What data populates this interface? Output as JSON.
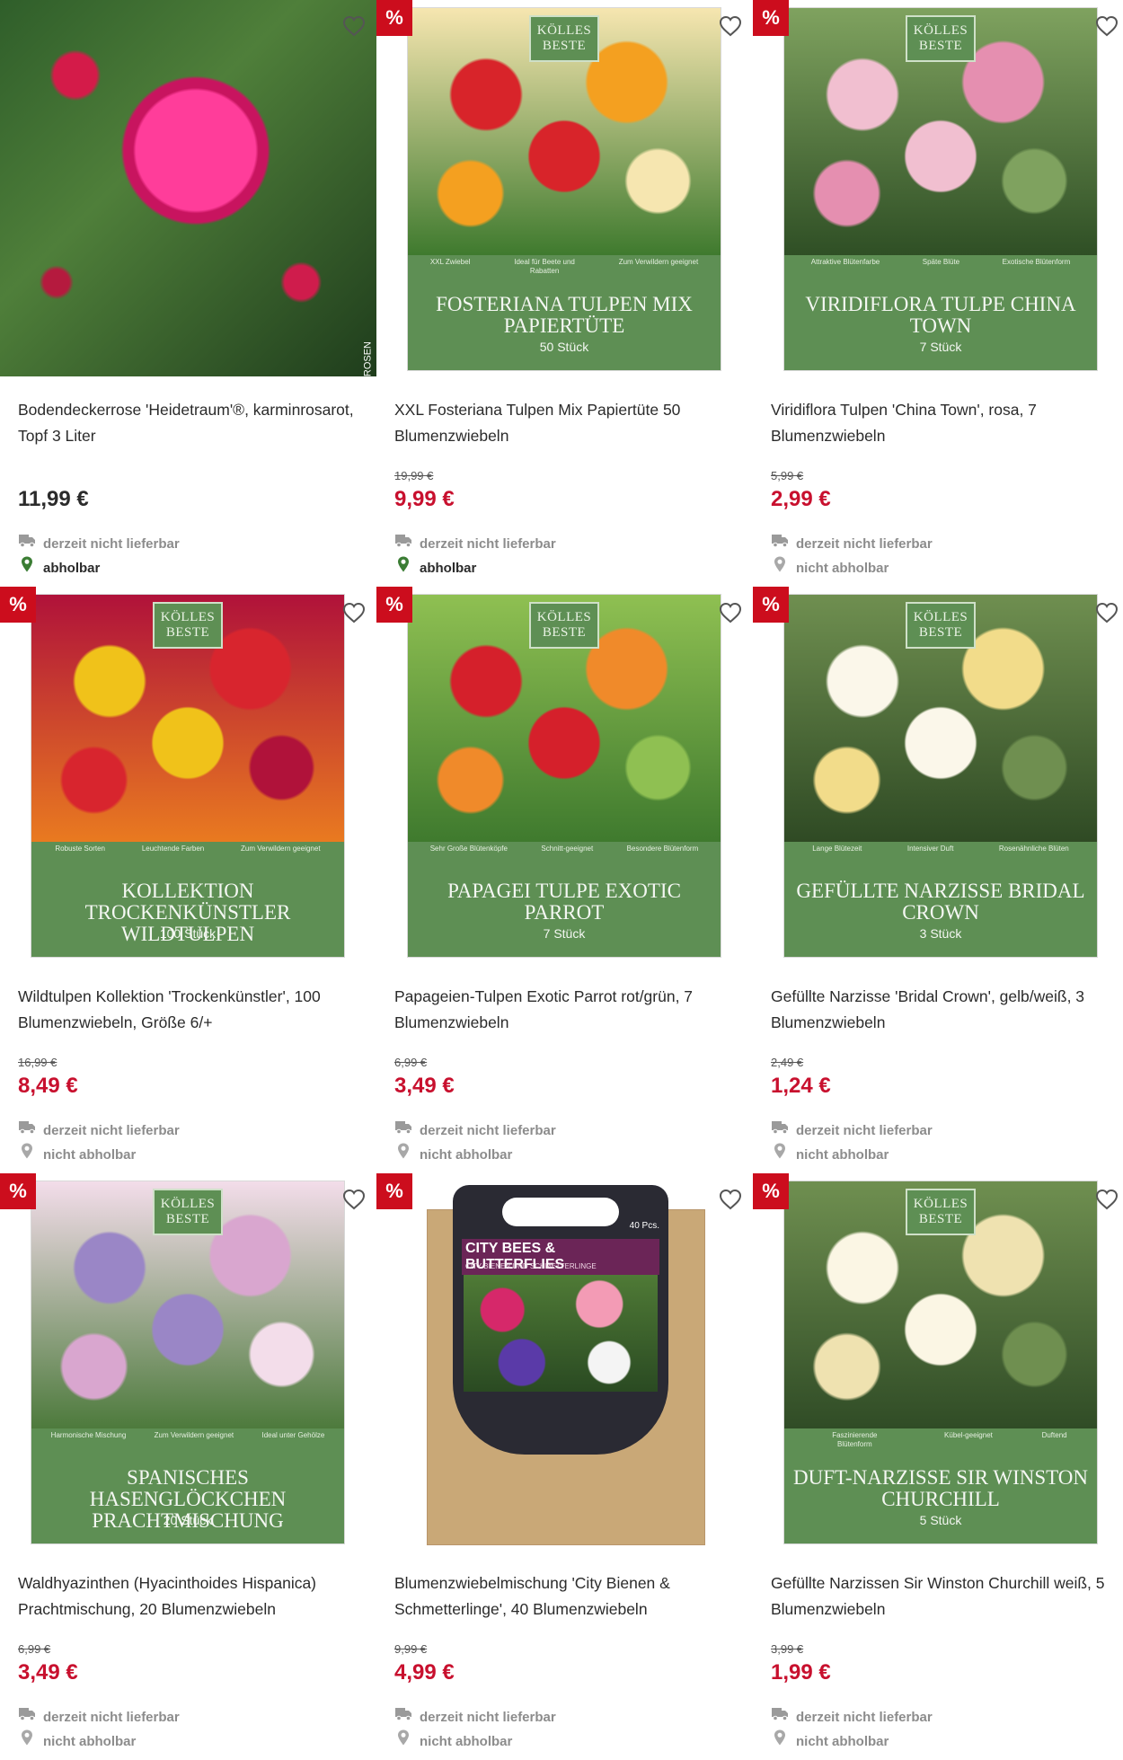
{
  "colors": {
    "sale_badge": "#cc0d1d",
    "sale_price": "#c8102e",
    "pack_green": "#5e8f54",
    "available_pin": "#3b7d34",
    "unavailable_text": "#8c8c8c"
  },
  "products": [
    {
      "title": "Bodendeckerrose 'Heidetraum'®, karminrosarot, Topf 3 Liter",
      "old_price": "",
      "price": "11,99 €",
      "sale": false,
      "delivery": "derzeit nicht lieferbar",
      "pickup": "abholbar",
      "pickup_available": true,
      "image": {
        "kind": "rose-photo",
        "credit": "© NOACK ROSEN"
      }
    },
    {
      "title": "XXL Fosteriana Tulpen Mix Papiertüte 50 Blumenzwiebeln",
      "old_price": "19,99 €",
      "price": "9,99 €",
      "sale": true,
      "delivery": "derzeit nicht lieferbar",
      "pickup": "abholbar",
      "pickup_available": true,
      "image": {
        "kind": "pack",
        "brand": "KÖLLES BESTE",
        "photo_colors": [
          "#d8242a",
          "#f4a020",
          "#f6e6b0",
          "#3f7a2e"
        ],
        "features": [
          "XXL Zwiebel",
          "Ideal für Beete und Rabatten",
          "Zum Verwildern geeignet"
        ],
        "pack_title": "FOSTERIANA TULPEN MIX PAPIERTÜTE",
        "count": "50 Stück"
      }
    },
    {
      "title": "Viridiflora Tulpen 'China Town', rosa, 7 Blumenzwiebeln",
      "old_price": "5,99 €",
      "price": "2,99 €",
      "sale": true,
      "delivery": "derzeit nicht lieferbar",
      "pickup": "nicht abholbar",
      "pickup_available": false,
      "image": {
        "kind": "pack",
        "brand": "KÖLLES BESTE",
        "photo_colors": [
          "#f1bfd0",
          "#e58fb0",
          "#7fa25f",
          "#2f4f25"
        ],
        "features": [
          "Attraktive Blütenfarbe",
          "Späte Blüte",
          "Exotische Blütenform"
        ],
        "pack_title": "VIRIDIFLORA TULPE CHINA TOWN",
        "count": "7 Stück"
      }
    },
    {
      "title": "Wildtulpen Kollektion 'Trockenkünstler', 100 Blumenzwiebeln, Größe 6/+",
      "old_price": "16,99 €",
      "price": "8,49 €",
      "sale": true,
      "delivery": "derzeit nicht lieferbar",
      "pickup": "nicht abholbar",
      "pickup_available": false,
      "image": {
        "kind": "pack",
        "brand": "KÖLLES BESTE",
        "photo_colors": [
          "#f0c21a",
          "#d8252e",
          "#b0123a",
          "#e97a20"
        ],
        "features": [
          "Robuste Sorten",
          "Leuchtende Farben",
          "Zum Verwildern geeignet"
        ],
        "pack_title": "KOLLEKTION TROCKENKÜNSTLER WILDTULPEN",
        "count": "100 Stück"
      }
    },
    {
      "title": "Papageien-Tulpen Exotic Parrot rot/grün, 7 Blumenzwiebeln",
      "old_price": "6,99 €",
      "price": "3,49 €",
      "sale": true,
      "delivery": "derzeit nicht lieferbar",
      "pickup": "nicht abholbar",
      "pickup_available": false,
      "image": {
        "kind": "pack",
        "brand": "KÖLLES BESTE",
        "photo_colors": [
          "#d5202b",
          "#f08a2a",
          "#8fc052",
          "#3f7a2e"
        ],
        "features": [
          "Sehr Große Blütenköpfe",
          "Schnitt-geeignet",
          "Besondere Blütenform"
        ],
        "pack_title": "PAPAGEI TULPE EXOTIC PARROT",
        "count": "7 Stück"
      }
    },
    {
      "title": "Gefüllte Narzisse 'Bridal Crown', gelb/weiß, 3 Blumenzwiebeln",
      "old_price": "2,49 €",
      "price": "1,24 €",
      "sale": true,
      "delivery": "derzeit nicht lieferbar",
      "pickup": "nicht abholbar",
      "pickup_available": false,
      "image": {
        "kind": "pack",
        "brand": "KÖLLES BESTE",
        "photo_colors": [
          "#fbf7ea",
          "#f2dc8a",
          "#6f8f50",
          "#2f4a24"
        ],
        "features": [
          "Lange Blütezeit",
          "Intensiver Duft",
          "Rosenähnliche Blüten"
        ],
        "pack_title": "GEFÜLLTE NARZISSE BRIDAL CROWN",
        "count": "3 Stück"
      }
    },
    {
      "title": "Waldhyazinthen (Hyacinthoides Hispanica) Prachtmischung, 20 Blumenzwiebeln",
      "old_price": "6,99 €",
      "price": "3,49 €",
      "sale": true,
      "delivery": "derzeit nicht lieferbar",
      "pickup": "nicht abholbar",
      "pickup_available": false,
      "image": {
        "kind": "pack",
        "brand": "KÖLLES BESTE",
        "photo_colors": [
          "#9a86c6",
          "#d9a6cf",
          "#f3ddea",
          "#4d7a3c"
        ],
        "features": [
          "Harmonische Mischung",
          "Zum Verwildern geeignet",
          "Ideal unter Gehölze"
        ],
        "pack_title": "SPANISCHES HASENGLÖCKCHEN PRACHTMISCHUNG",
        "count": "20 Stück"
      }
    },
    {
      "title": "Blumenzwiebelmischung 'City Bienen & Schmetterlinge', 40 Blumenzwiebeln",
      "old_price": "9,99 €",
      "price": "4,99 €",
      "sale": true,
      "delivery": "derzeit nicht lieferbar",
      "pickup": "nicht abholbar",
      "pickup_available": false,
      "image": {
        "kind": "city-bag",
        "brand_line": "CITY BEES & BUTTERFLIES",
        "subline": "CITY BIENEN UND SCHMETTERLINGE",
        "count": "40 Pcs."
      }
    },
    {
      "title": "Gefüllte Narzissen Sir Winston Churchill weiß, 5 Blumenzwiebeln",
      "old_price": "3,99 €",
      "price": "1,99 €",
      "sale": true,
      "delivery": "derzeit nicht lieferbar",
      "pickup": "nicht abholbar",
      "pickup_available": false,
      "image": {
        "kind": "pack",
        "brand": "KÖLLES BESTE",
        "photo_colors": [
          "#fbf6e4",
          "#efe2b0",
          "#6f8f50",
          "#304c26"
        ],
        "features": [
          "Faszinierende Blütenform",
          "Kübel-geeignet",
          "Duftend"
        ],
        "pack_title": "DUFT-NARZISSE SIR WINSTON CHURCHILL",
        "count": "5 Stück"
      }
    }
  ],
  "sale_badge_label": "%",
  "icons": {
    "wishlist": "heart-outline-icon",
    "delivery": "delivery-truck-icon",
    "pickup": "location-pin-icon"
  }
}
